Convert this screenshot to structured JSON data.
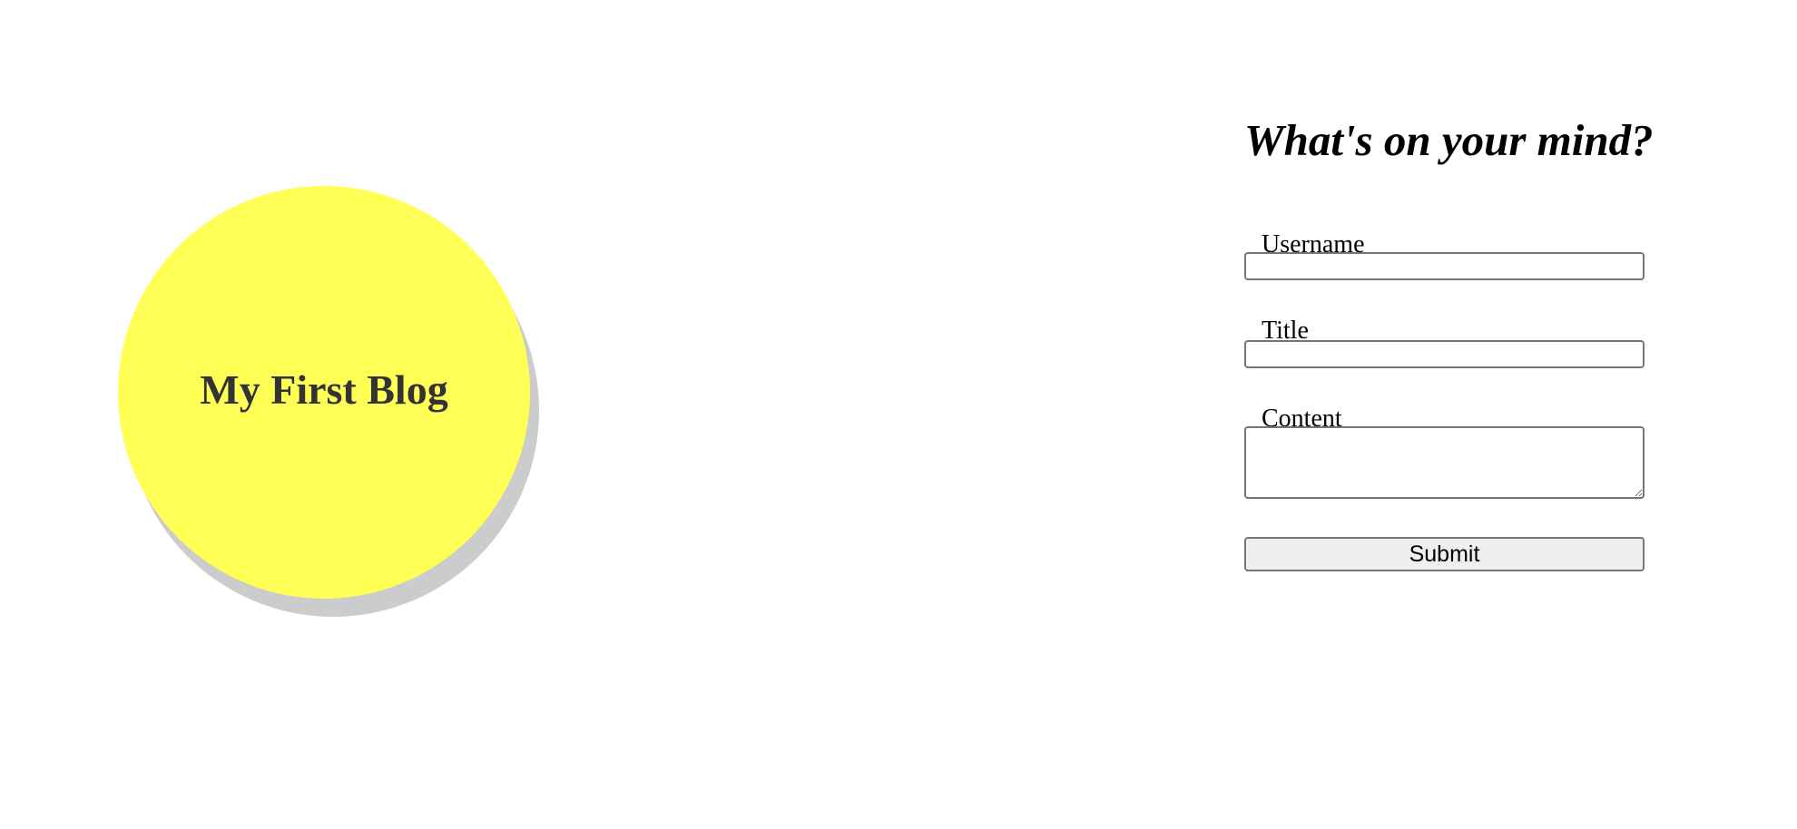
{
  "blog": {
    "title": "My First Blog",
    "circle_color": "#ffff55",
    "shadow_color": "#cccccc"
  },
  "form": {
    "heading": "What's on your mind?",
    "username_label": "Username",
    "username_value": "",
    "title_label": "Title",
    "title_value": "",
    "content_label": "Content",
    "content_value": "",
    "submit_label": "Submit"
  }
}
